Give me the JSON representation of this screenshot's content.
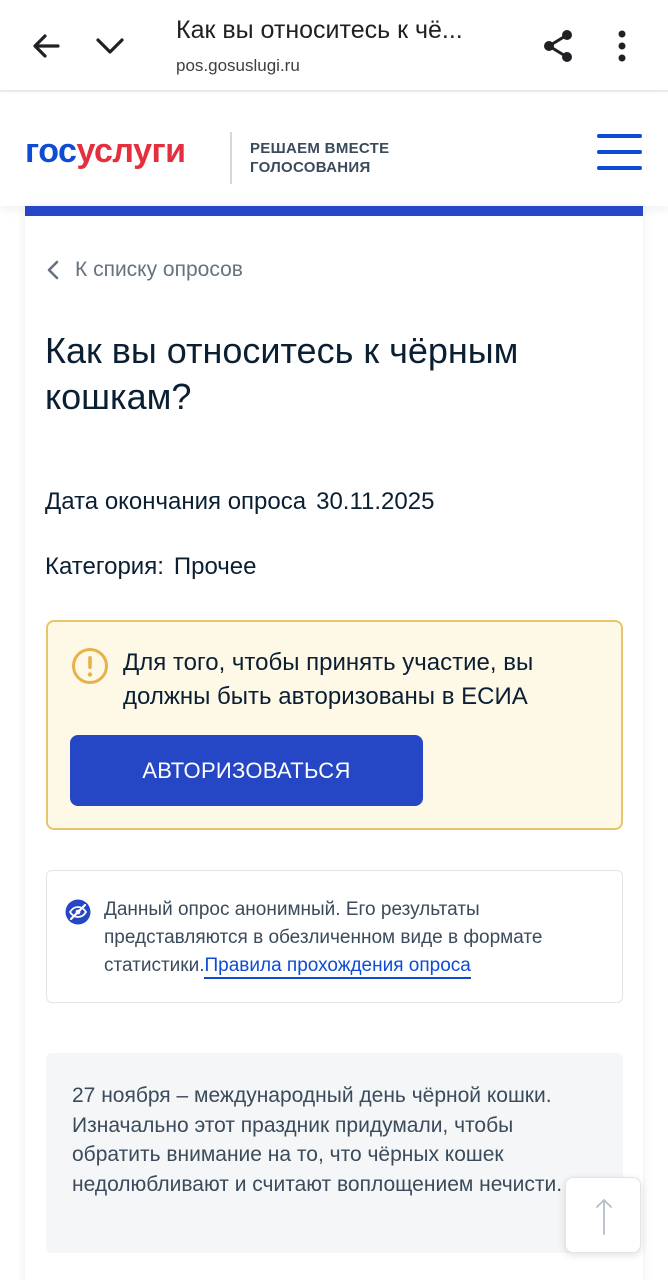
{
  "browser": {
    "title": "Как вы относитесь к чё...",
    "url": "pos.gosuslugi.ru",
    "icons": [
      "arrow-back-icon",
      "chevron-down-icon",
      "share-icon",
      "more-vert-icon"
    ]
  },
  "header": {
    "logo_part1": "гос",
    "logo_part2": "услуги",
    "tagline_line1": "РЕШАЕМ ВМЕСТЕ",
    "tagline_line2": "ГОЛОСОВАНИЯ",
    "brand_blue": "#0d4cd3",
    "brand_red": "#e52e3e"
  },
  "poll": {
    "back_link": "К списку опросов",
    "title": "Как вы относитесь к чёрным кошкам?",
    "end_date_label": "Дата окончания опроса",
    "end_date_value": "30.11.2025",
    "category_label": "Категория:",
    "category_value": "Прочее"
  },
  "warning": {
    "text": "Для того, чтобы принять участие, вы должны быть авторизованы в ЕСИА",
    "button_label": "АВТОРИЗОВАТЬСЯ",
    "button_color": "#2547c5"
  },
  "anonymous": {
    "text": "Данный опрос анонимный. Его результаты представляются в обезличенном виде в формате статистики.",
    "link": "Правила прохождения опроса"
  },
  "description": {
    "text": "27 ноября – международный день чёрной кошки. Изначально этот праздник придумали, чтобы обратить внимание на то, что чёрных кошек недолюбливают и считают воплощением нечисти."
  }
}
